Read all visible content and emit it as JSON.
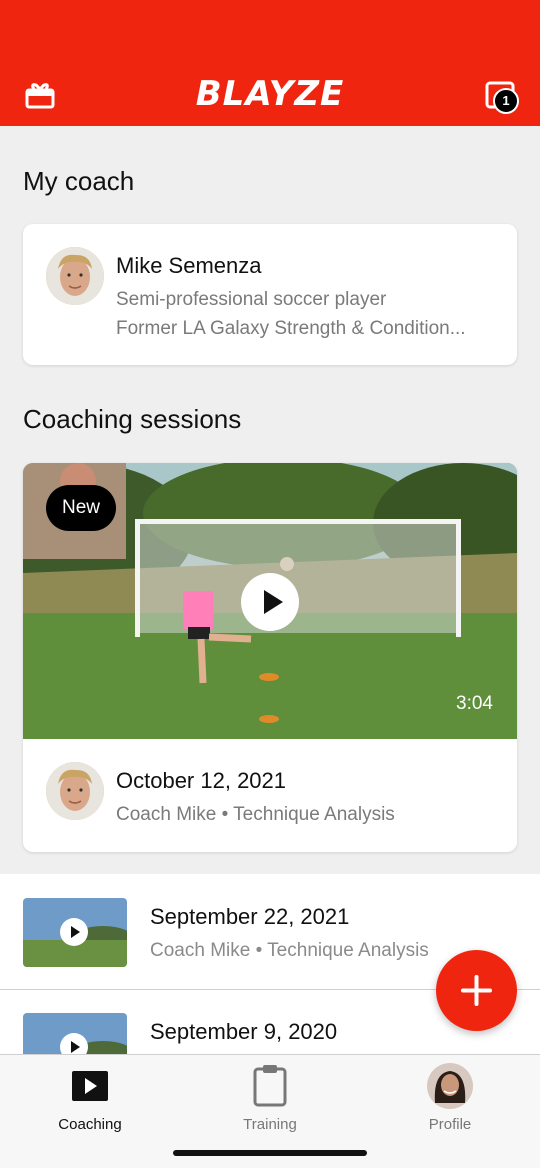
{
  "header": {
    "logo": "BLAYZE",
    "gift_icon": "gift-icon",
    "inbox_icon": "inbox-icon",
    "notification_count": "1",
    "brand_color": "#f0250f"
  },
  "my_coach": {
    "title": "My coach",
    "name": "Mike Semenza",
    "line1": "Semi-professional soccer player",
    "line2": "Former LA Galaxy Strength & Condition..."
  },
  "sessions": {
    "title": "Coaching sessions",
    "featured": {
      "badge": "New",
      "duration": "3:04",
      "date": "October 12, 2021",
      "meta": "Coach Mike • Technique Analysis"
    },
    "list": [
      {
        "date": "September 22, 2021",
        "meta": "Coach Mike • Technique Analysis"
      },
      {
        "date": "September 9, 2020",
        "meta": ""
      }
    ]
  },
  "fab": {
    "icon": "plus-icon"
  },
  "tabs": [
    {
      "label": "Coaching",
      "icon": "play-icon",
      "active": true
    },
    {
      "label": "Training",
      "icon": "clipboard-icon",
      "active": false
    },
    {
      "label": "Profile",
      "icon": "avatar",
      "active": false
    }
  ]
}
